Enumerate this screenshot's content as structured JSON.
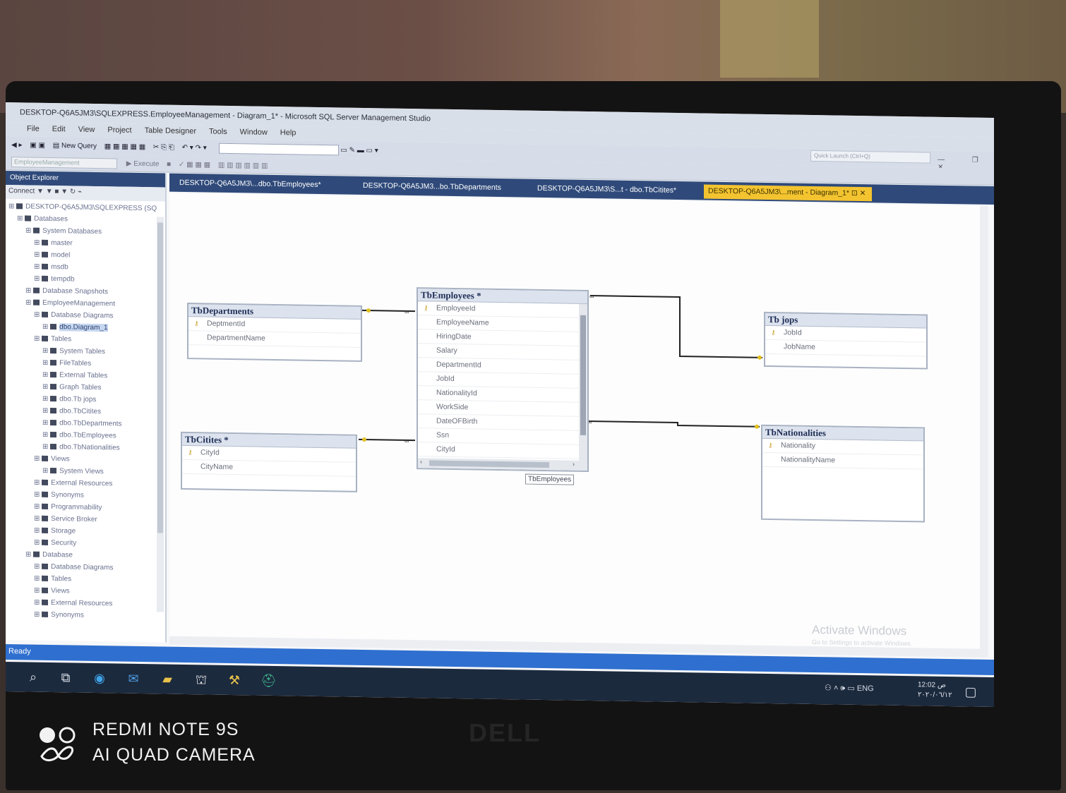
{
  "window": {
    "title": "DESKTOP-Q6A5JM3\\SQLEXPRESS.EmployeeManagement - Diagram_1* - Microsoft SQL Server Management Studio",
    "quick_launch_placeholder": "Quick Launch (Ctrl+Q)"
  },
  "menu": [
    "File",
    "Edit",
    "View",
    "Project",
    "Table Designer",
    "Tools",
    "Window",
    "Help"
  ],
  "toolbar": {
    "new_query": "New Query",
    "execute": "Execute",
    "database": "EmployeeManagement"
  },
  "object_explorer": {
    "title": "Object Explorer",
    "connect": "Connect",
    "items": [
      {
        "label": "DESKTOP-Q6A5JM3\\SQLEXPRESS (SQ",
        "level": 0
      },
      {
        "label": "Databases",
        "level": 1
      },
      {
        "label": "System Databases",
        "level": 2
      },
      {
        "label": "master",
        "level": 3
      },
      {
        "label": "model",
        "level": 3
      },
      {
        "label": "msdb",
        "level": 3
      },
      {
        "label": "tempdb",
        "level": 3
      },
      {
        "label": "Database Snapshots",
        "level": 2
      },
      {
        "label": "EmployeeManagement",
        "level": 2
      },
      {
        "label": "Database Diagrams",
        "level": 3
      },
      {
        "label": "dbo.Diagram_1",
        "level": 4,
        "selected": true
      },
      {
        "label": "Tables",
        "level": 3
      },
      {
        "label": "System Tables",
        "level": 4
      },
      {
        "label": "FileTables",
        "level": 4
      },
      {
        "label": "External Tables",
        "level": 4
      },
      {
        "label": "Graph Tables",
        "level": 4
      },
      {
        "label": "dbo.Tb jops",
        "level": 4
      },
      {
        "label": "dbo.TbCitites",
        "level": 4
      },
      {
        "label": "dbo.TbDepartments",
        "level": 4
      },
      {
        "label": "dbo.TbEmployees",
        "level": 4
      },
      {
        "label": "dbo.TbNationalities",
        "level": 4
      },
      {
        "label": "Views",
        "level": 3
      },
      {
        "label": "System Views",
        "level": 4
      },
      {
        "label": "External Resources",
        "level": 3
      },
      {
        "label": "Synonyms",
        "level": 3
      },
      {
        "label": "Programmability",
        "level": 3
      },
      {
        "label": "Service Broker",
        "level": 3
      },
      {
        "label": "Storage",
        "level": 3
      },
      {
        "label": "Security",
        "level": 3
      },
      {
        "label": "Database",
        "level": 2
      },
      {
        "label": "Database Diagrams",
        "level": 3
      },
      {
        "label": "Tables",
        "level": 3
      },
      {
        "label": "Views",
        "level": 3
      },
      {
        "label": "External Resources",
        "level": 3
      },
      {
        "label": "Synonyms",
        "level": 3
      }
    ]
  },
  "tabs": [
    {
      "label": "DESKTOP-Q6A5JM3\\...dbo.TbEmployees*",
      "active": false
    },
    {
      "label": "DESKTOP-Q6A5JM3...bo.TbDepartments",
      "active": false
    },
    {
      "label": "DESKTOP-Q6A5JM3\\S...t - dbo.TbCitites*",
      "active": false
    },
    {
      "label": "DESKTOP-Q6A5JM3\\...ment - Diagram_1*",
      "active": true
    }
  ],
  "tables": {
    "departments": {
      "title": "TbDepartments",
      "columns": [
        "DeptmentId",
        "DepartmentName"
      ]
    },
    "employees": {
      "title": "TbEmployees *",
      "columns": [
        "EmployeeId",
        "EmployeeName",
        "HiringDate",
        "Salary",
        "DepartmentId",
        "JobId",
        "NationalityId",
        "WorkSide",
        "DateOFBirth",
        "Ssn",
        "CityId"
      ]
    },
    "jops": {
      "title": "Tb jops",
      "columns": [
        "JobId",
        "JobName"
      ]
    },
    "cities": {
      "title": "TbCitites *",
      "columns": [
        "CityId",
        "CityName"
      ]
    },
    "nationalities": {
      "title": "TbNationalities",
      "columns": [
        "Nationality",
        "NationalityName"
      ]
    }
  },
  "tooltip": "TbEmployees",
  "activate": {
    "title": "Activate Windows",
    "sub": "Go to Settings to activate Windows."
  },
  "status": "Ready",
  "taskbar": {
    "lang": "ENG",
    "time": "12:02 ص",
    "date": "٢٠٢٠/٠٦/١٢"
  },
  "watermark": {
    "line1": "REDMI NOTE 9S",
    "line2": "AI QUAD CAMERA"
  },
  "brand": "DELL",
  "colors": {
    "accent": "#2f4a7a",
    "active_tab": "#f4c430",
    "status": "#2f6fcf"
  }
}
